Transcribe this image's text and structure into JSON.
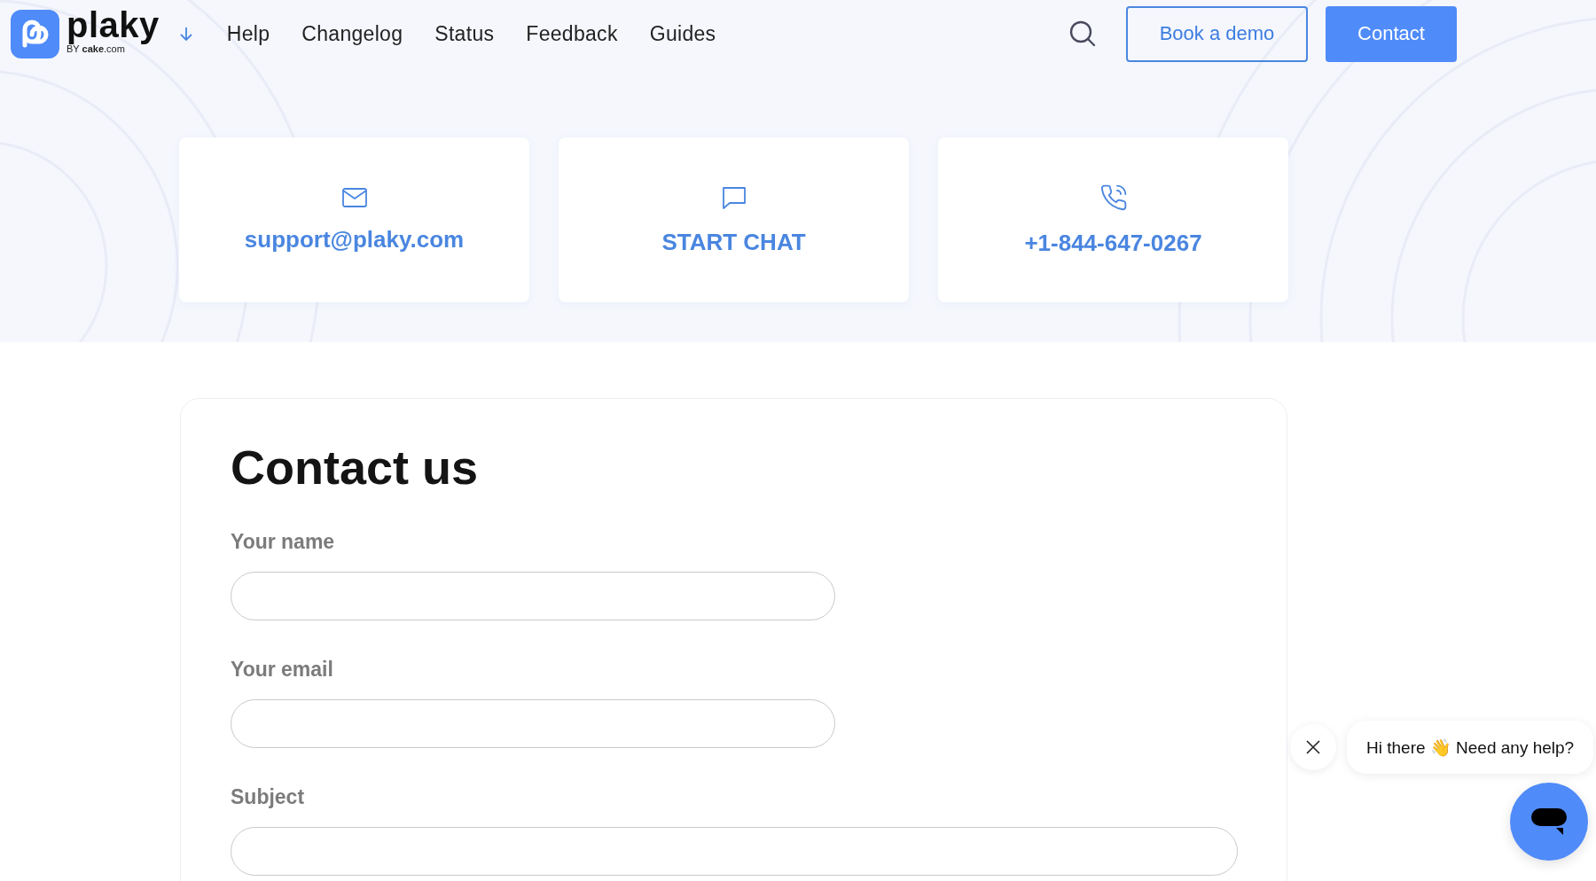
{
  "header": {
    "logo": {
      "name": "plaky",
      "byline_prefix": "BY",
      "byline_brand": "cake",
      "byline_suffix": ".com"
    },
    "nav": [
      "Help",
      "Changelog",
      "Status",
      "Feedback",
      "Guides"
    ],
    "book_demo": "Book a demo",
    "contact": "Contact"
  },
  "contact_cards": [
    {
      "kind": "email",
      "text": "support@plaky.com"
    },
    {
      "kind": "chat",
      "text": "START CHAT"
    },
    {
      "kind": "phone",
      "text": "+1-844-647-0267"
    }
  ],
  "form": {
    "title": "Contact us",
    "fields": [
      {
        "label": "Your name",
        "kind": "short"
      },
      {
        "label": "Your email",
        "kind": "short"
      },
      {
        "label": "Subject",
        "kind": "full"
      }
    ]
  },
  "chat_widget": {
    "message": "Hi there 👋 Need any help?"
  }
}
